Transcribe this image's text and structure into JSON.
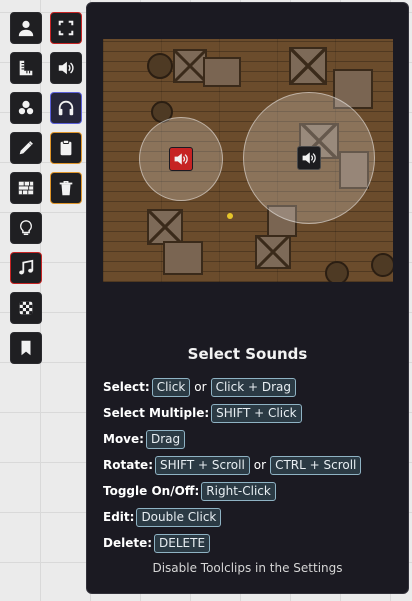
{
  "toolbar": {
    "left": [
      {
        "name": "token-tool",
        "icon": "person-icon"
      },
      {
        "name": "measure-tool",
        "icon": "ruler-icon"
      },
      {
        "name": "shapes-tool",
        "icon": "shapes-icon"
      },
      {
        "name": "draw-tool",
        "icon": "pencil-icon"
      },
      {
        "name": "wall-tool",
        "icon": "brick-wall-icon"
      },
      {
        "name": "lighting-tool",
        "icon": "lightbulb-icon"
      },
      {
        "name": "sounds-tool",
        "icon": "music-note-icon",
        "active": true
      },
      {
        "name": "tiles-tool",
        "icon": "checkerboard-icon"
      },
      {
        "name": "notes-tool",
        "icon": "bookmark-icon"
      }
    ],
    "right": [
      {
        "name": "select-sounds",
        "icon": "expand-select-icon"
      },
      {
        "name": "place-sound",
        "icon": "speaker-icon"
      },
      {
        "name": "preview-sound",
        "icon": "headphones-icon"
      },
      {
        "name": "paste-sound",
        "icon": "clipboard-icon"
      },
      {
        "name": "clear-sounds",
        "icon": "trash-icon"
      }
    ]
  },
  "tooltip": {
    "title": "Select Sounds",
    "rows": [
      {
        "label": "Select:",
        "keys": [
          "Click",
          "Click + Drag"
        ],
        "sep": "or"
      },
      {
        "label": "Select Multiple:",
        "keys": [
          "SHIFT + Click"
        ]
      },
      {
        "label": "Move:",
        "keys": [
          "Drag"
        ]
      },
      {
        "label": "Rotate:",
        "keys": [
          "SHIFT + Scroll",
          "CTRL + Scroll"
        ],
        "sep": "or"
      },
      {
        "label": "Toggle On/Off:",
        "keys": [
          "Right-Click"
        ]
      },
      {
        "label": "Edit:",
        "keys": [
          "Double Click"
        ]
      },
      {
        "label": "Delete:",
        "keys": [
          "DELETE"
        ]
      }
    ],
    "footer": "Disable Toolclips in the Settings"
  },
  "colors": {
    "active_border": "#c62323",
    "orange_border": "#e0962b",
    "blue_border": "#5a5fd8",
    "key_border": "#8fb3c4"
  }
}
